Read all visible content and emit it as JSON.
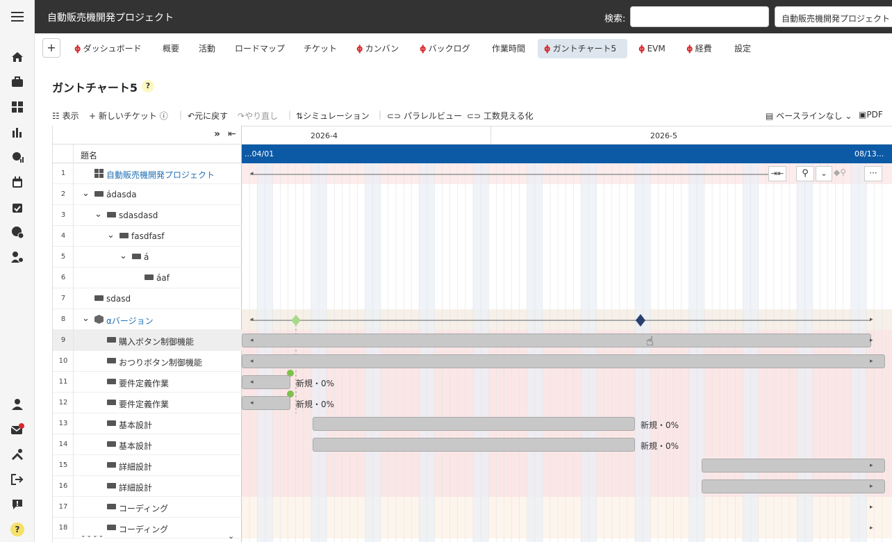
{
  "app": {
    "project_title": "自動販売機開発プロジェクト",
    "search_label": "検索:",
    "project_button": "自動販売機開発プロジェクト"
  },
  "tabs": [
    {
      "label": "ダッシュボード",
      "icon": true
    },
    {
      "label": "概要",
      "icon": false
    },
    {
      "label": "活動",
      "icon": false
    },
    {
      "label": "ロードマップ",
      "icon": false
    },
    {
      "label": "チケット",
      "icon": false
    },
    {
      "label": "カンバン",
      "icon": true
    },
    {
      "label": "バックログ",
      "icon": true
    },
    {
      "label": "作業時間",
      "icon": false
    },
    {
      "label": "ガントチャート5",
      "icon": true,
      "active": true
    },
    {
      "label": "EVM",
      "icon": true
    },
    {
      "label": "経費",
      "icon": true
    },
    {
      "label": "設定",
      "icon": false
    }
  ],
  "page": {
    "title": "ガントチャート5",
    "help": "?"
  },
  "toolbar": {
    "display": "表示",
    "new_ticket": "新しいチケット",
    "undo": "元に戻す",
    "redo": "やり直し",
    "simulation": "シミュレーション",
    "parallel_view": "パラレルビュー",
    "effort_view": "工数見える化",
    "baseline": "ベースラインなし",
    "pdf": "PDF"
  },
  "grid": {
    "column_title": "題名"
  },
  "timeline": {
    "month1": "2026-4",
    "month2": "2026-5",
    "range_start": "...04/01",
    "range_end": "08/13..."
  },
  "rows": [
    {
      "num": "1",
      "title": "自動販売機開発プロジェクト",
      "indent": 0,
      "icon": "project-icon",
      "link": true
    },
    {
      "num": "2",
      "title": "ádasda",
      "indent": 0,
      "toggle": true,
      "icon": "ticket-icon"
    },
    {
      "num": "3",
      "title": "sdasdasd",
      "indent": 1,
      "toggle": true,
      "icon": "ticket-icon"
    },
    {
      "num": "4",
      "title": "fasdfasf",
      "indent": 2,
      "toggle": true,
      "icon": "ticket-icon"
    },
    {
      "num": "5",
      "title": "á",
      "indent": 3,
      "toggle": true,
      "icon": "ticket-icon"
    },
    {
      "num": "6",
      "title": "áaf",
      "indent": 4,
      "icon": "ticket-icon"
    },
    {
      "num": "7",
      "title": "sdasd",
      "indent": 0,
      "icon": "ticket-icon"
    },
    {
      "num": "8",
      "title": "αバージョン",
      "indent": 0,
      "toggle": true,
      "icon": "version-icon",
      "link": true
    },
    {
      "num": "9",
      "title": "購入ボタン制御機能",
      "indent": 1,
      "icon": "ticket-icon",
      "selected": true
    },
    {
      "num": "10",
      "title": "おつりボタン制御機能",
      "indent": 1,
      "icon": "ticket-icon"
    },
    {
      "num": "11",
      "title": "要件定義作業",
      "indent": 1,
      "icon": "ticket-icon"
    },
    {
      "num": "12",
      "title": "要件定義作業",
      "indent": 1,
      "icon": "ticket-icon"
    },
    {
      "num": "13",
      "title": "基本設計",
      "indent": 1,
      "icon": "ticket-icon"
    },
    {
      "num": "14",
      "title": "基本設計",
      "indent": 1,
      "icon": "ticket-icon"
    },
    {
      "num": "15",
      "title": "詳細設計",
      "indent": 1,
      "icon": "ticket-icon"
    },
    {
      "num": "16",
      "title": "詳細設計",
      "indent": 1,
      "icon": "ticket-icon"
    },
    {
      "num": "17",
      "title": "コーディング",
      "indent": 1,
      "icon": "ticket-icon"
    },
    {
      "num": "18",
      "title": "コーディング",
      "indent": 1,
      "icon": "ticket-icon"
    }
  ],
  "bar_labels": {
    "new_zero": "新規・0%"
  },
  "colors": {
    "topbar": "#333333",
    "timeline_band": "#0c5aa6",
    "accent_red": "#d9262b",
    "milestone": "#2b3f6e",
    "start_marker": "#7dc04b"
  }
}
